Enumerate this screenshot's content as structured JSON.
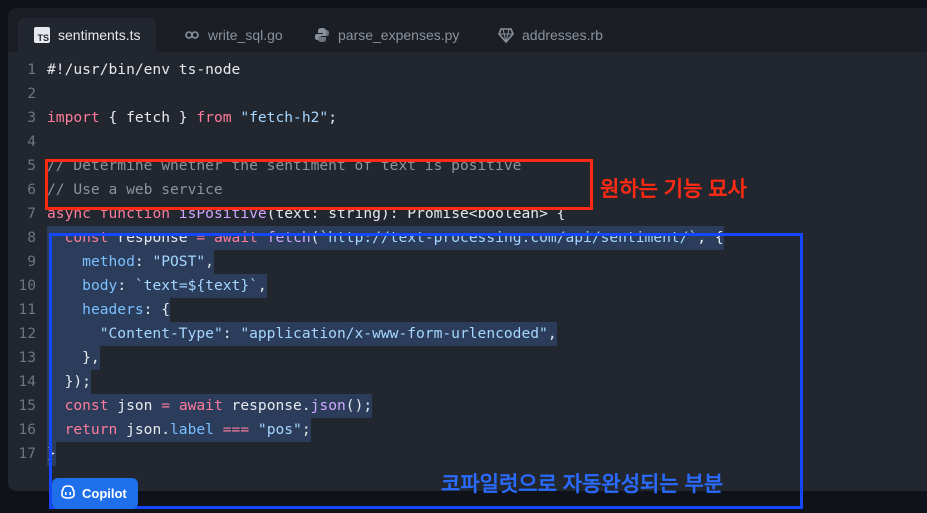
{
  "tabs": [
    {
      "label": "sentiments.ts",
      "icon": "typescript-icon",
      "active": true
    },
    {
      "label": "write_sql.go",
      "icon": "go-icon",
      "active": false
    },
    {
      "label": "parse_expenses.py",
      "icon": "python-icon",
      "active": false
    },
    {
      "label": "addresses.rb",
      "icon": "ruby-icon",
      "active": false
    }
  ],
  "ts_badge": "TS",
  "line_numbers": [
    "1",
    "2",
    "3",
    "4",
    "5",
    "6",
    "7",
    "8",
    "9",
    "10",
    "11",
    "12",
    "13",
    "14",
    "15",
    "16",
    "17"
  ],
  "code_lines": [
    {
      "tokens": [
        {
          "t": "#!/usr/bin/env ts-node",
          "c": ""
        }
      ]
    },
    {
      "tokens": []
    },
    {
      "tokens": [
        {
          "t": "import",
          "c": "kw"
        },
        {
          "t": " { fetch } ",
          "c": ""
        },
        {
          "t": "from",
          "c": "kw"
        },
        {
          "t": " ",
          "c": ""
        },
        {
          "t": "\"fetch-h2\"",
          "c": "str"
        },
        {
          "t": ";",
          "c": ""
        }
      ]
    },
    {
      "tokens": []
    },
    {
      "tokens": [
        {
          "t": "// Determine whether the sentiment of text is positive",
          "c": "cm"
        }
      ]
    },
    {
      "tokens": [
        {
          "t": "// Use a web service",
          "c": "cm"
        }
      ]
    },
    {
      "tokens": [
        {
          "t": "async",
          "c": "kw"
        },
        {
          "t": " ",
          "c": ""
        },
        {
          "t": "function",
          "c": "kw"
        },
        {
          "t": " ",
          "c": ""
        },
        {
          "t": "isPositive",
          "c": "fn"
        },
        {
          "t": "(text: string): Promise<boolean> {",
          "c": ""
        }
      ]
    },
    {
      "hl": true,
      "tokens": [
        {
          "t": "  ",
          "c": ""
        },
        {
          "t": "const",
          "c": "kw"
        },
        {
          "t": " response ",
          "c": ""
        },
        {
          "t": "=",
          "c": "kw"
        },
        {
          "t": " ",
          "c": ""
        },
        {
          "t": "await",
          "c": "kw"
        },
        {
          "t": " ",
          "c": ""
        },
        {
          "t": "fetch",
          "c": "fn"
        },
        {
          "t": "(",
          "c": ""
        },
        {
          "t": "`http://text-processing.com/api/sentiment/`",
          "c": "str"
        },
        {
          "t": ", {",
          "c": ""
        }
      ]
    },
    {
      "hl": true,
      "tokens": [
        {
          "t": "    ",
          "c": ""
        },
        {
          "t": "method",
          "c": "prop"
        },
        {
          "t": ": ",
          "c": ""
        },
        {
          "t": "\"POST\"",
          "c": "str"
        },
        {
          "t": ",",
          "c": ""
        }
      ]
    },
    {
      "hl": true,
      "tokens": [
        {
          "t": "    ",
          "c": ""
        },
        {
          "t": "body",
          "c": "prop"
        },
        {
          "t": ": ",
          "c": ""
        },
        {
          "t": "`text=${text}`",
          "c": "str"
        },
        {
          "t": ",",
          "c": ""
        }
      ]
    },
    {
      "hl": true,
      "tokens": [
        {
          "t": "    ",
          "c": ""
        },
        {
          "t": "headers",
          "c": "prop"
        },
        {
          "t": ": {",
          "c": ""
        }
      ]
    },
    {
      "hl": true,
      "tokens": [
        {
          "t": "      ",
          "c": ""
        },
        {
          "t": "\"Content-Type\"",
          "c": "str"
        },
        {
          "t": ": ",
          "c": ""
        },
        {
          "t": "\"application/x-www-form-urlencoded\"",
          "c": "str"
        },
        {
          "t": ",",
          "c": ""
        }
      ]
    },
    {
      "hl": true,
      "tokens": [
        {
          "t": "    },",
          "c": ""
        }
      ]
    },
    {
      "hl": true,
      "tokens": [
        {
          "t": "  });",
          "c": ""
        }
      ]
    },
    {
      "hl": true,
      "tokens": [
        {
          "t": "  ",
          "c": ""
        },
        {
          "t": "const",
          "c": "kw"
        },
        {
          "t": " json ",
          "c": ""
        },
        {
          "t": "=",
          "c": "kw"
        },
        {
          "t": " ",
          "c": ""
        },
        {
          "t": "await",
          "c": "kw"
        },
        {
          "t": " response.",
          "c": ""
        },
        {
          "t": "json",
          "c": "fn"
        },
        {
          "t": "();",
          "c": ""
        }
      ]
    },
    {
      "hl": true,
      "tokens": [
        {
          "t": "  ",
          "c": ""
        },
        {
          "t": "return",
          "c": "kw"
        },
        {
          "t": " json.",
          "c": ""
        },
        {
          "t": "label",
          "c": "prop"
        },
        {
          "t": " ",
          "c": ""
        },
        {
          "t": "===",
          "c": "kw"
        },
        {
          "t": " ",
          "c": ""
        },
        {
          "t": "\"pos\"",
          "c": "str"
        },
        {
          "t": ";",
          "c": ""
        }
      ]
    },
    {
      "hl": true,
      "tokens": [
        {
          "t": "}",
          "c": ""
        }
      ]
    }
  ],
  "annotations": {
    "red_label": "원하는 기능 묘사",
    "blue_label": "코파일럿으로 자동완성되는 부분"
  },
  "copilot_button": {
    "label": "Copilot",
    "icon": "copilot-icon"
  },
  "colors": {
    "keyword": "#ff7b9a",
    "function": "#d2a8ff",
    "string": "#a5d6ff",
    "property": "#79c0ff",
    "comment": "#8b949e",
    "annotation_red": "#ff2a14",
    "annotation_blue": "#1547ff"
  }
}
